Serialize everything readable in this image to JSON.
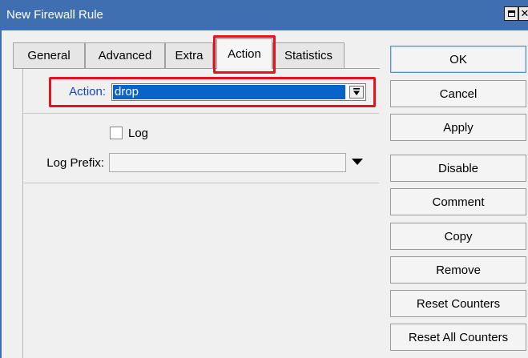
{
  "window": {
    "title": "New Firewall Rule"
  },
  "tabs": [
    {
      "label": "General"
    },
    {
      "label": "Advanced"
    },
    {
      "label": "Extra"
    },
    {
      "label": "Action",
      "active": true
    },
    {
      "label": "Statistics"
    }
  ],
  "form": {
    "action_label": "Action:",
    "action_value": "drop",
    "log_label": "Log",
    "log_checked": false,
    "log_prefix_label": "Log Prefix:",
    "log_prefix_value": ""
  },
  "buttons": {
    "ok": "OK",
    "cancel": "Cancel",
    "apply": "Apply",
    "disable": "Disable",
    "comment": "Comment",
    "copy": "Copy",
    "remove": "Remove",
    "reset_counters": "Reset Counters",
    "reset_all_counters": "Reset All Counters"
  },
  "colors": {
    "titlebar": "#3f6fb0",
    "selection": "#0a63c9",
    "highlight_box": "#e8121d",
    "action_label": "#1a3fd0"
  },
  "icons": {
    "maximize": "maximize-icon",
    "close": "close-icon",
    "dropdown": "dropdown-arrow-icon"
  }
}
